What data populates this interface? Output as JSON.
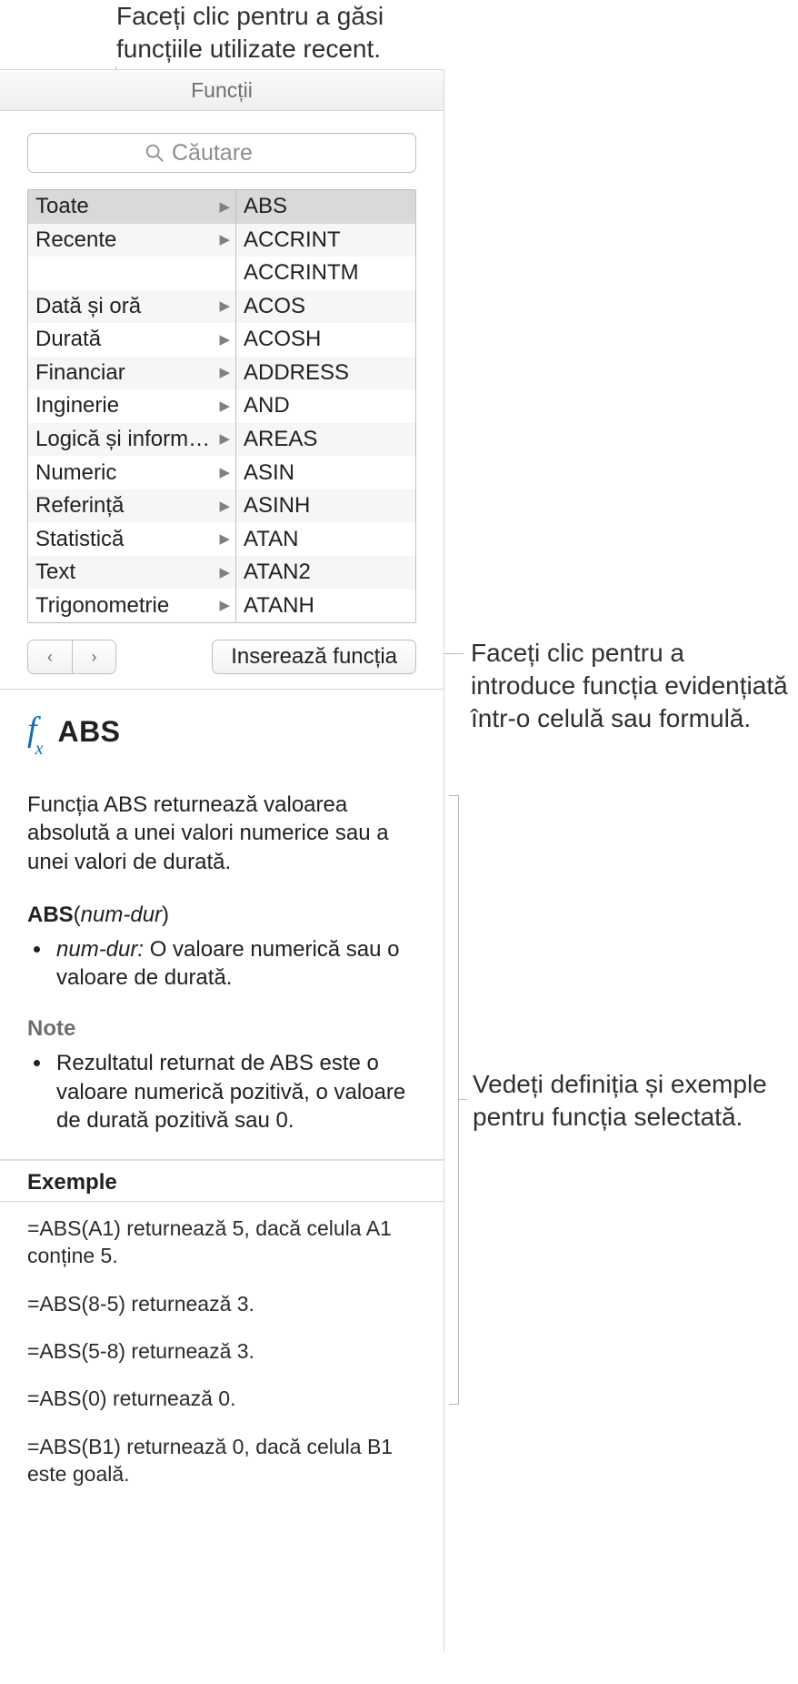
{
  "callouts": {
    "top": "Faceți clic pentru a găsi funcțiile utilizate recent.",
    "insert": "Faceți clic pentru a introduce funcția evidențiată într-o celulă sau formulă.",
    "help": "Vedeți definiția și exemple pentru funcția selectată."
  },
  "panel": {
    "title": "Funcții",
    "search_placeholder": "Căutare",
    "categories": [
      {
        "label": "Toate",
        "selected": true
      },
      {
        "label": "Recente"
      },
      {
        "label": ""
      },
      {
        "label": "Dată și oră"
      },
      {
        "label": "Durată"
      },
      {
        "label": "Financiar"
      },
      {
        "label": "Inginerie"
      },
      {
        "label": "Logică și informații"
      },
      {
        "label": "Numeric"
      },
      {
        "label": "Referință"
      },
      {
        "label": "Statistică"
      },
      {
        "label": "Text"
      },
      {
        "label": "Trigonometrie"
      }
    ],
    "functions": [
      {
        "label": "ABS",
        "selected": true
      },
      {
        "label": "ACCRINT"
      },
      {
        "label": "ACCRINTM"
      },
      {
        "label": "ACOS"
      },
      {
        "label": "ACOSH"
      },
      {
        "label": "ADDRESS"
      },
      {
        "label": "AND"
      },
      {
        "label": "AREAS"
      },
      {
        "label": "ASIN"
      },
      {
        "label": "ASINH"
      },
      {
        "label": "ATAN"
      },
      {
        "label": "ATAN2"
      },
      {
        "label": "ATANH"
      }
    ],
    "insert_label": "Inserează funcția"
  },
  "detail": {
    "fx_label": "fx",
    "name": "ABS",
    "description": "Funcția ABS returnează valoarea absolută a unei valori numerice sau a unei valori de durată.",
    "signature_name": "ABS",
    "signature_args": "num-dur",
    "arg_name": "num-dur:",
    "arg_desc": " O valoare numerică sau o valoare de durată.",
    "notes_heading": "Note",
    "note_1": "Rezultatul returnat de ABS este o valoare numerică pozitivă, o valoare de durată pozitivă sau 0.",
    "examples_heading": "Exemple",
    "examples": [
      "=ABS(A1) returnează 5, dacă celula A1 conține 5.",
      "=ABS(8-5) returnează 3.",
      "=ABS(5-8) returnează 3.",
      "=ABS(0) returnează 0.",
      "=ABS(B1) returnează 0, dacă celula B1 este goală."
    ]
  }
}
